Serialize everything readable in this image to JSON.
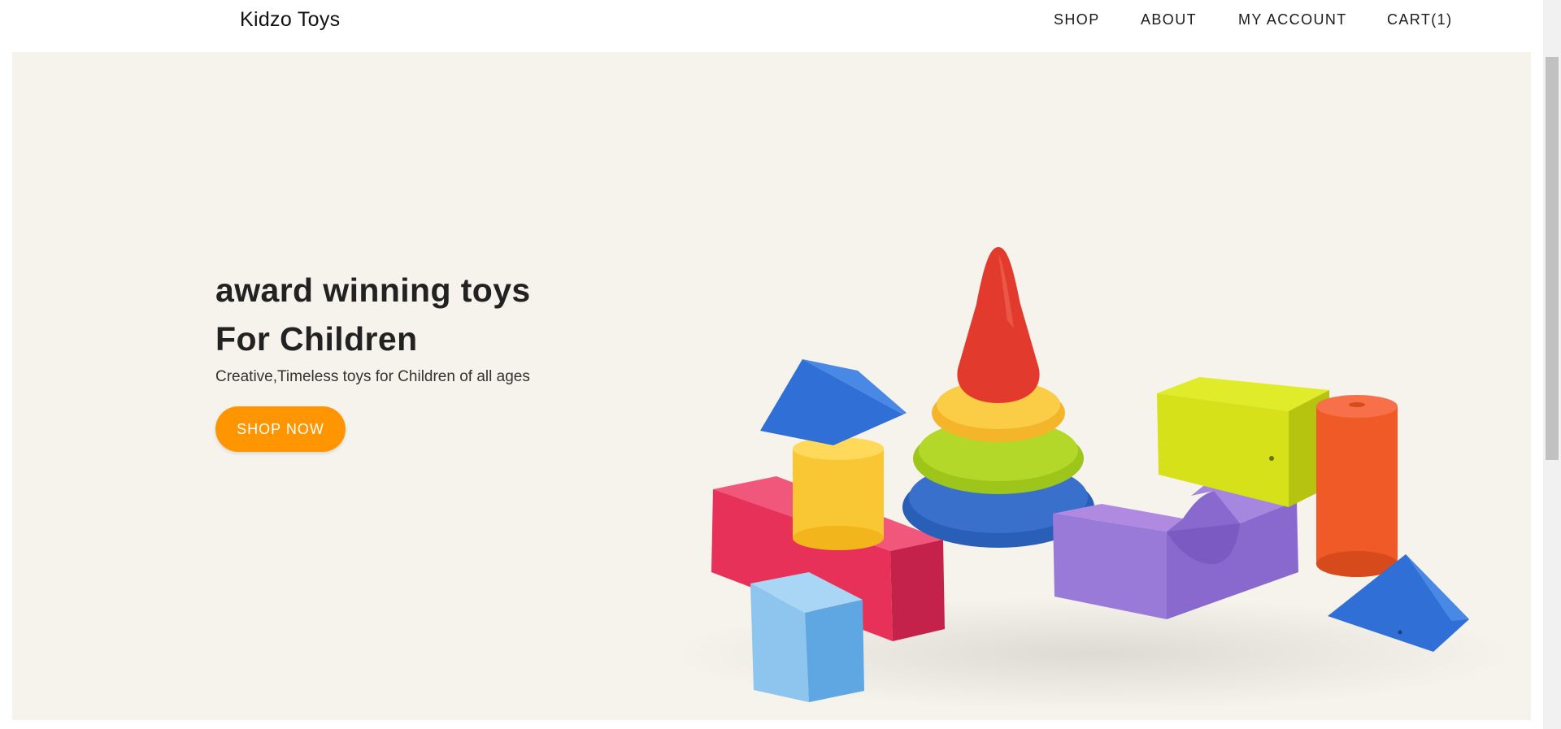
{
  "brand": {
    "name": "Kidzo Toys"
  },
  "nav": {
    "shop": "SHOP",
    "about": "ABOUT",
    "account": "MY ACCOUNT",
    "cart": "CART(1)"
  },
  "hero": {
    "title_line1": "award winning toys",
    "title_line2": "For Children",
    "subtitle": "Creative,Timeless toys for Children of all ages",
    "cta_label": "SHOP NOW"
  },
  "colors": {
    "accent": "#ff9500",
    "hero_background": "#f6f2ec",
    "text": "#222222"
  },
  "hero_image": {
    "toys": [
      "red cone",
      "yellow ring",
      "green ring",
      "blue ring",
      "blue triangle",
      "yellow cylinder",
      "pink block",
      "light-blue cube",
      "purple arch",
      "lime block",
      "orange cylinder",
      "blue triangle"
    ]
  }
}
